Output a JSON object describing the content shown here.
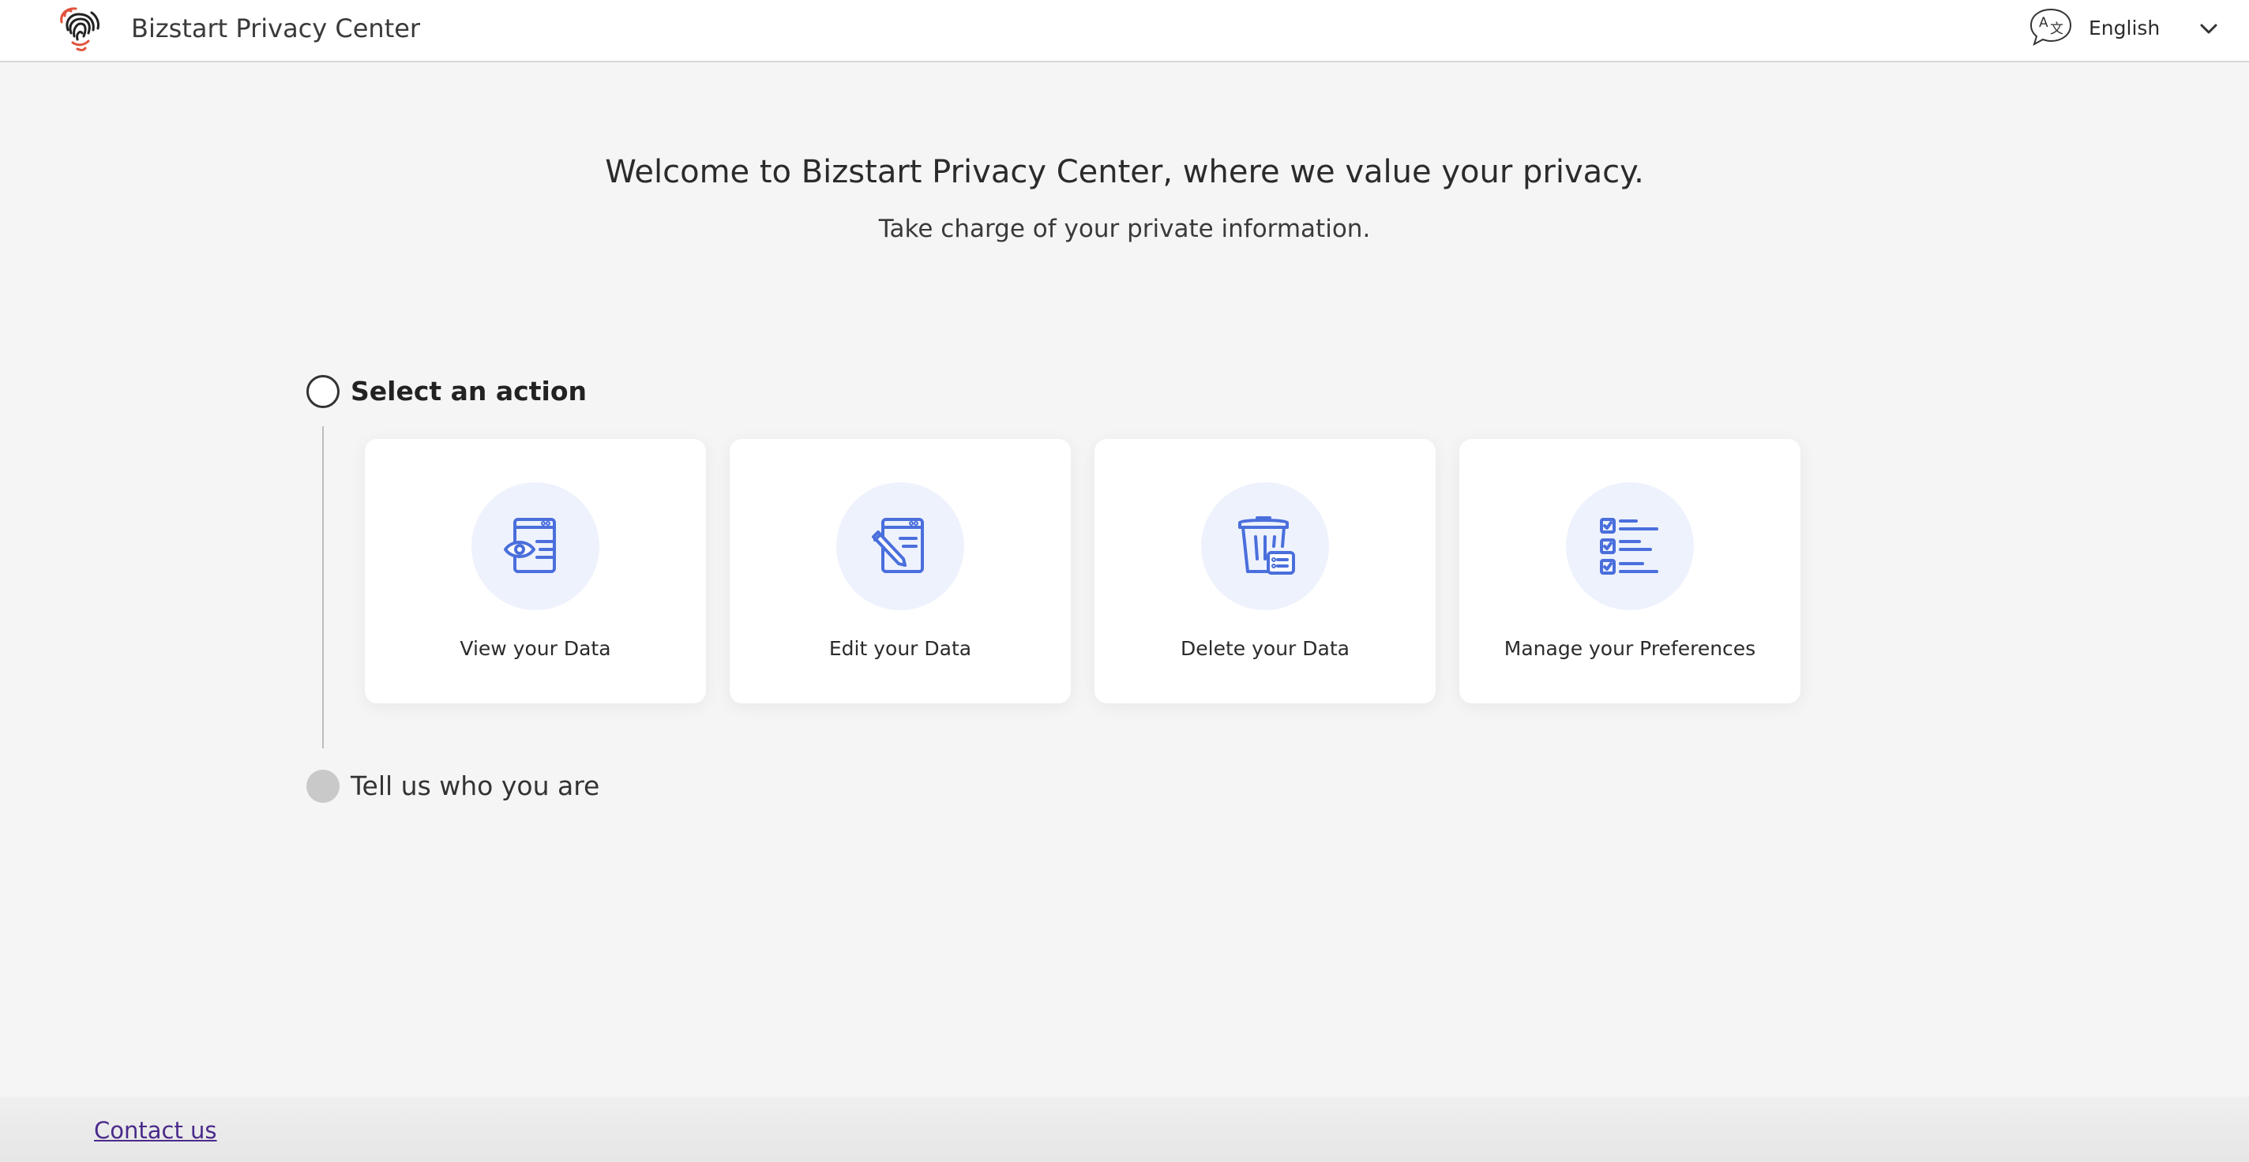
{
  "header": {
    "title": "Bizstart Privacy Center",
    "language": "English",
    "logo_icon": "fingerprint-icon",
    "language_icon": "translate-icon"
  },
  "hero": {
    "welcome": "Welcome to Bizstart Privacy Center, where we value your privacy.",
    "subtitle": "Take charge of your private information."
  },
  "steps": {
    "step1": "Select an action",
    "step2": "Tell us who you are"
  },
  "actions": [
    {
      "label": "View your Data",
      "icon": "view-data-icon"
    },
    {
      "label": "Edit your Data",
      "icon": "edit-data-icon"
    },
    {
      "label": "Delete your Data",
      "icon": "delete-data-icon"
    },
    {
      "label": "Manage your Preferences",
      "icon": "preferences-checklist-icon"
    }
  ],
  "footer": {
    "contact": "Contact us"
  },
  "colors": {
    "accent_icon": "#4a6fdc",
    "icon_circle_bg": "#eef2fd",
    "link": "#4a2a8a",
    "logo_accent": "#e0523c"
  }
}
